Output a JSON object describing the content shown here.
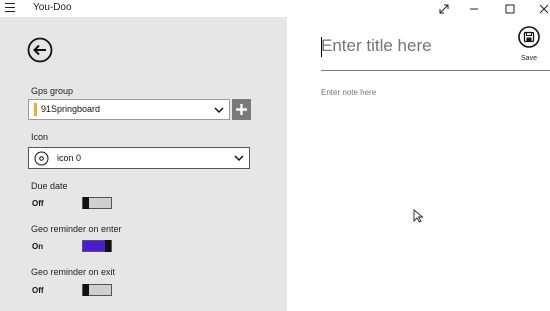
{
  "app": {
    "title": "You-Doo"
  },
  "window_controls": [
    "expand-icon",
    "minimize-icon",
    "maximize-icon",
    "close-icon"
  ],
  "left": {
    "gps_group_label": "Gps group",
    "gps_group_value": "91Springboard",
    "gps_group_accent": "#e8b030",
    "icon_label": "Icon",
    "icon_value": "icon 0",
    "due_date_label": "Due date",
    "due_date_state": "Off",
    "geo_enter_label": "Geo reminder on enter",
    "geo_enter_state": "On",
    "geo_exit_label": "Geo reminder on exit",
    "geo_exit_state": "Off"
  },
  "right": {
    "title_placeholder": "Enter title here",
    "save_label": "Save",
    "note_placeholder": "Enter note here"
  },
  "colors": {
    "pane_bg": "#e6e6e6",
    "toggle_on": "#4b1bd9",
    "add_btn": "#7a7a7a"
  }
}
